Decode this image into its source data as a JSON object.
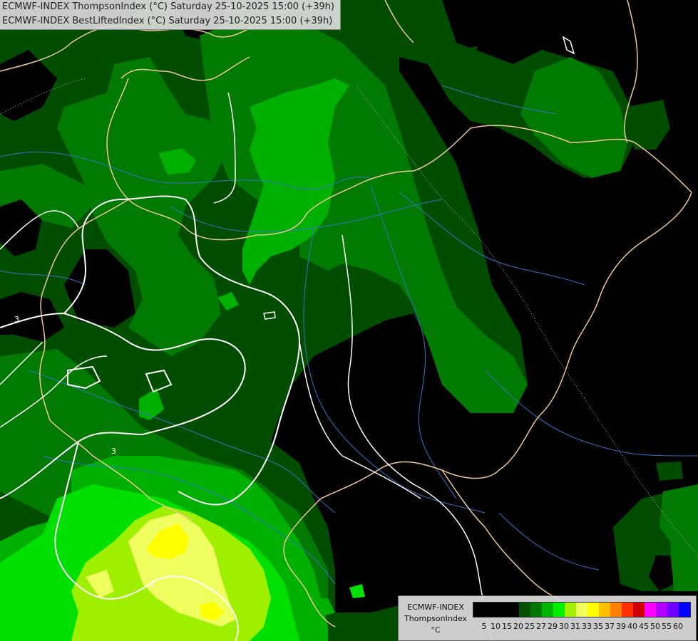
{
  "header": {
    "line1": "ECMWF-INDEX ThompsonIndex (°C) Saturday 25-10-2025 15:00 (+39h)",
    "line2": "ECMWF-INDEX BestLiftedIndex (°C) Saturday 25-10-2025 15:00 (+39h)"
  },
  "legend": {
    "model": "ECMWF-INDEX",
    "parameter": "ThompsonIndex",
    "unit": "°C",
    "ticks": [
      "5",
      "10",
      "15",
      "20",
      "25",
      "27",
      "29",
      "30",
      "31",
      "33",
      "35",
      "37",
      "39",
      "40",
      "45",
      "50",
      "55",
      "60"
    ],
    "colors": [
      "#000000",
      "#000000",
      "#000000",
      "#000000",
      "#005000",
      "#007800",
      "#00b400",
      "#00f000",
      "#a0f000",
      "#f0ff60",
      "#ffff00",
      "#ffc000",
      "#ff8000",
      "#ff3000",
      "#d00000",
      "#ff00ff",
      "#b000ff",
      "#7000ff",
      "#0000ff"
    ]
  },
  "map_colors": {
    "background": "#000000",
    "ti_low": "#004d00",
    "ti_mid": "#007a00",
    "ti_high": "#00b000",
    "ti_higher": "#00e000",
    "ti_lime": "#9ff000",
    "ti_pale": "#f0ff60",
    "ti_yellow": "#ffff00",
    "border": "#f0c898",
    "river": "#3a72c8",
    "contour": "#ffffff"
  },
  "contour_labels": [
    "3",
    "3",
    "3"
  ]
}
